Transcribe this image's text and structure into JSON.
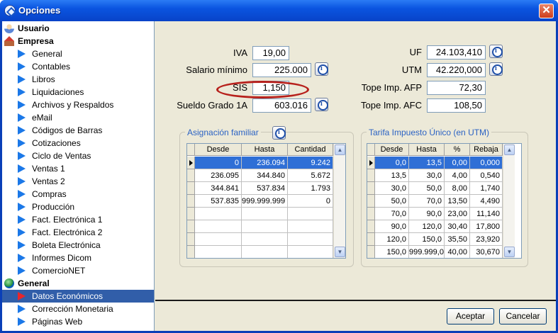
{
  "window": {
    "title": "Opciones",
    "close": "✕"
  },
  "tree": [
    {
      "type": "group",
      "label": "Usuario",
      "icon": "user-icon"
    },
    {
      "type": "group",
      "label": "Empresa",
      "icon": "house-icon"
    },
    {
      "type": "item",
      "label": "General"
    },
    {
      "type": "item",
      "label": "Contables"
    },
    {
      "type": "item",
      "label": "Libros"
    },
    {
      "type": "item",
      "label": "Liquidaciones"
    },
    {
      "type": "item",
      "label": "Archivos y Respaldos"
    },
    {
      "type": "item",
      "label": "eMail"
    },
    {
      "type": "item",
      "label": "Códigos de Barras"
    },
    {
      "type": "item",
      "label": "Cotizaciones"
    },
    {
      "type": "item",
      "label": "Ciclo de Ventas"
    },
    {
      "type": "item",
      "label": "Ventas 1"
    },
    {
      "type": "item",
      "label": "Ventas 2"
    },
    {
      "type": "item",
      "label": "Compras"
    },
    {
      "type": "item",
      "label": "Producción"
    },
    {
      "type": "item",
      "label": "Fact. Electrónica 1"
    },
    {
      "type": "item",
      "label": "Fact. Electrónica 2"
    },
    {
      "type": "item",
      "label": "Boleta Electrónica"
    },
    {
      "type": "item",
      "label": "Informes Dicom"
    },
    {
      "type": "item",
      "label": "ComercioNET"
    },
    {
      "type": "group",
      "label": "General",
      "icon": "globe-icon"
    },
    {
      "type": "item",
      "label": "Datos Económicos",
      "selected": true
    },
    {
      "type": "item",
      "label": "Corrección Monetaria"
    },
    {
      "type": "item",
      "label": "Páginas Web"
    }
  ],
  "fields": {
    "iva": {
      "label": "IVA",
      "value": "19,00"
    },
    "salario": {
      "label": "Salario mínimo",
      "value": "225.000"
    },
    "sis": {
      "label": "SIS",
      "value": "1,150"
    },
    "sueldo": {
      "label": "Sueldo Grado 1A",
      "value": "603.016"
    },
    "uf": {
      "label": "UF",
      "value": "24.103,410"
    },
    "utm": {
      "label": "UTM",
      "value": "42.220,000"
    },
    "afp": {
      "label": "Tope Imp. AFP",
      "value": "72,30"
    },
    "afc": {
      "label": "Tope Imp. AFC",
      "value": "108,50"
    }
  },
  "asignacion": {
    "title": "Asignación familiar",
    "columns": [
      "Desde",
      "Hasta",
      "Cantidad"
    ],
    "rows": [
      [
        "0",
        "236.094",
        "9.242"
      ],
      [
        "236.095",
        "344.840",
        "5.672"
      ],
      [
        "344.841",
        "537.834",
        "1.793"
      ],
      [
        "537.835",
        "999.999.999",
        "0"
      ]
    ]
  },
  "tarifa": {
    "title": "Tarifa Impuesto Único (en UTM)",
    "columns": [
      "Desde",
      "Hasta",
      "%",
      "Rebaja"
    ],
    "rows": [
      [
        "0,0",
        "13,5",
        "0,00",
        "0,000"
      ],
      [
        "13,5",
        "30,0",
        "4,00",
        "0,540"
      ],
      [
        "30,0",
        "50,0",
        "8,00",
        "1,740"
      ],
      [
        "50,0",
        "70,0",
        "13,50",
        "4,490"
      ],
      [
        "70,0",
        "90,0",
        "23,00",
        "11,140"
      ],
      [
        "90,0",
        "120,0",
        "30,40",
        "17,800"
      ],
      [
        "120,0",
        "150,0",
        "35,50",
        "23,920"
      ],
      [
        "150,0",
        "999.999,0",
        "40,00",
        "30,670"
      ]
    ]
  },
  "buttons": {
    "accept": "Aceptar",
    "cancel": "Cancelar"
  }
}
